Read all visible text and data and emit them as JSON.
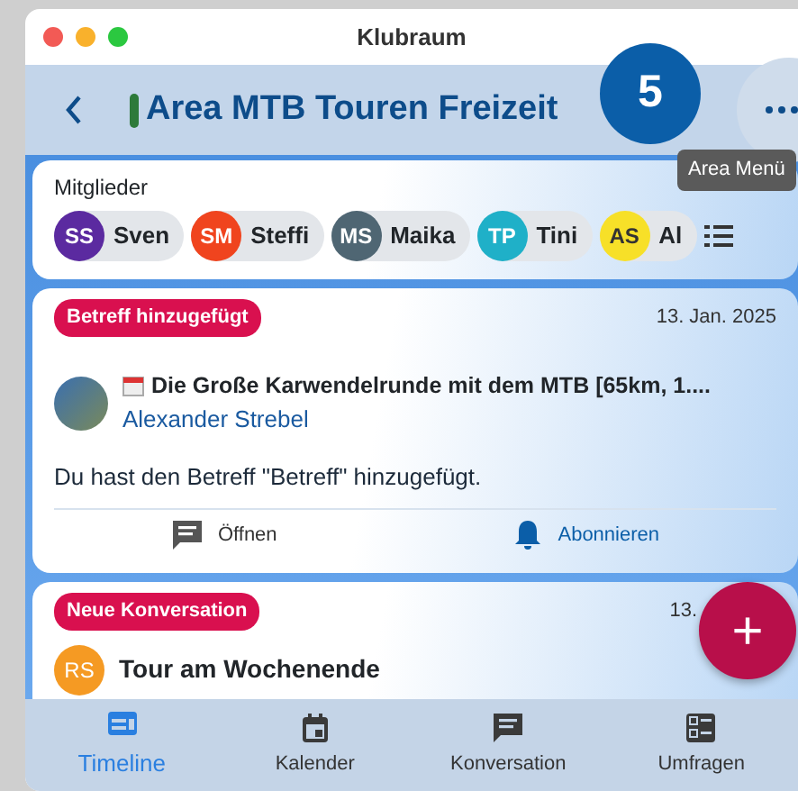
{
  "window": {
    "title": "Klubraum"
  },
  "header": {
    "title": "Area MTB Touren Freizeit",
    "badge": "5",
    "tooltip": "Area Menü"
  },
  "members": {
    "label": "Mitglieder",
    "chips": [
      {
        "initials": "SS",
        "name": "Sven",
        "color": "#5b2aa0"
      },
      {
        "initials": "SM",
        "name": "Steffi",
        "color": "#f0441e"
      },
      {
        "initials": "MS",
        "name": "Maika",
        "color": "#4f6673"
      },
      {
        "initials": "TP",
        "name": "Tini",
        "color": "#1fb0c8"
      },
      {
        "initials": "AS",
        "name": "Al",
        "color": "#f7e028"
      }
    ]
  },
  "feed": [
    {
      "kind": "event",
      "tag": "Betreff hinzugefügt",
      "date": "13. Jan. 2025",
      "title": "Die Große Karwendelrunde mit dem MTB [65km, 1....",
      "author": "Alexander Strebel",
      "message": "Du hast den Betreff \"Betreff\" hinzugefügt.",
      "actions": [
        {
          "kind": "open",
          "label": "Öffnen"
        },
        {
          "kind": "subscribe",
          "label": "Abonnieren"
        }
      ]
    },
    {
      "kind": "conversation",
      "tag": "Neue Konversation",
      "date": "13.",
      "title": "Tour am Wochenende",
      "avatar": {
        "initials": "RS",
        "color": "#f59a23"
      }
    }
  ],
  "fab": "+",
  "nav": [
    {
      "kind": "timeline",
      "label": "Timeline",
      "selected": true
    },
    {
      "kind": "calendar",
      "label": "Kalender",
      "selected": false
    },
    {
      "kind": "conversation",
      "label": "Konversation",
      "selected": false
    },
    {
      "kind": "polls",
      "label": "Umfragen",
      "selected": false
    }
  ]
}
